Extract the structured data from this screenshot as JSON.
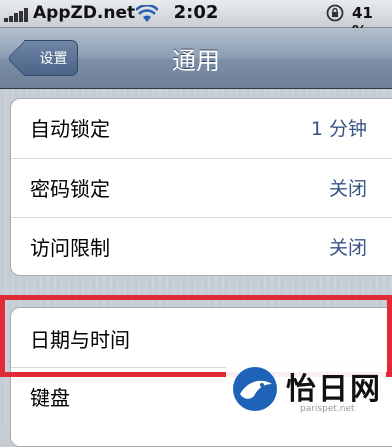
{
  "status_bar": {
    "carrier": "AppZD.net",
    "time": "2:02",
    "battery": "41 %",
    "signal_bars": 5
  },
  "nav": {
    "back_label": "设置",
    "title": "通用"
  },
  "groups": [
    {
      "rows": [
        {
          "label": "自动锁定",
          "value": "1 分钟"
        },
        {
          "label": "密码锁定",
          "value": "关闭"
        },
        {
          "label": "访问限制",
          "value": "关闭"
        }
      ]
    },
    {
      "rows": [
        {
          "label": "日期与时间",
          "value": ""
        },
        {
          "label": "键盘",
          "value": ""
        }
      ]
    }
  ],
  "watermark": {
    "text": "怡日网",
    "subtext": "parispet.net"
  },
  "colors": {
    "highlight": "#e02a36",
    "value_text": "#385487",
    "nav_bar": "#7d90a8"
  }
}
